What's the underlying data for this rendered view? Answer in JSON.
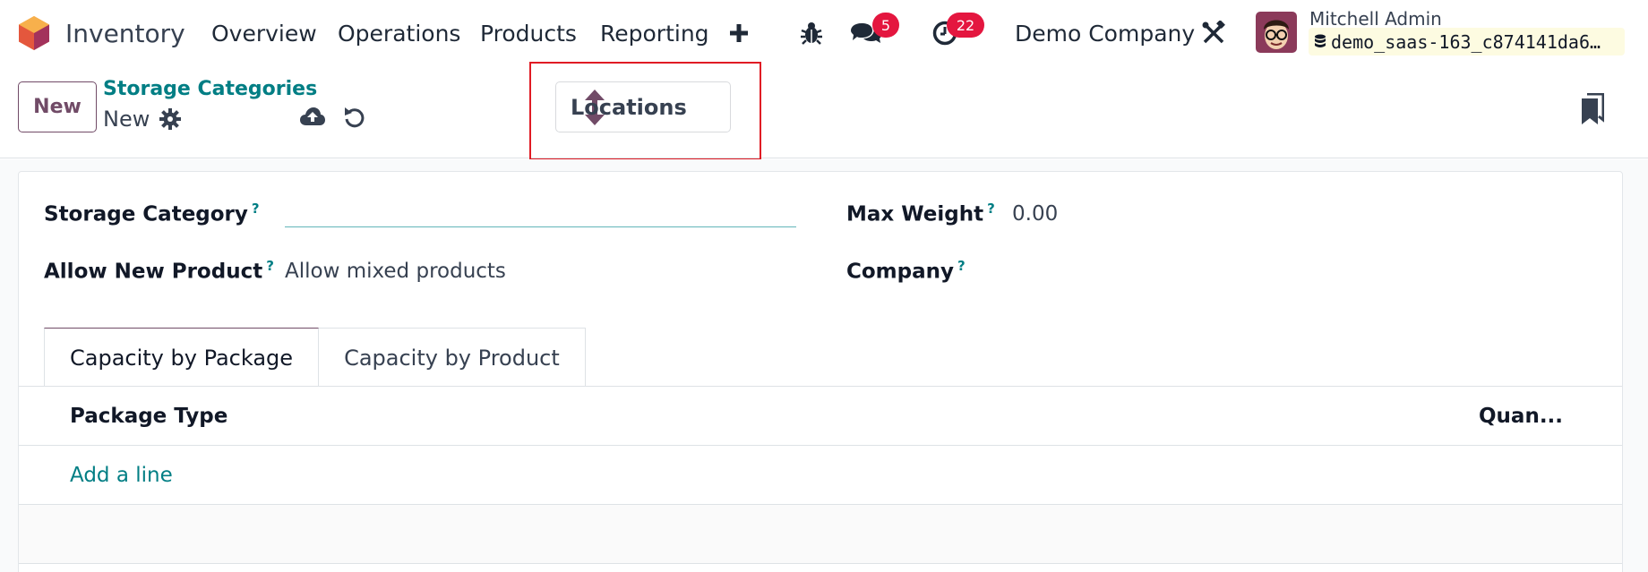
{
  "navbar": {
    "app_name": "Inventory",
    "menu": [
      "Overview",
      "Operations",
      "Products",
      "Reporting"
    ],
    "messages_count": "5",
    "activities_count": "22",
    "company": "Demo Company",
    "user_name": "Mitchell Admin",
    "database": "demo_saas-163_c874141da6…"
  },
  "control_panel": {
    "new_label": "New",
    "breadcrumb_parent": "Storage Categories",
    "breadcrumb_current": "New",
    "smart_button_label": "Locations"
  },
  "form": {
    "storage_category_label": "Storage Category",
    "storage_category_value": "",
    "allow_new_product_label": "Allow New Product",
    "allow_new_product_value": "Allow mixed products",
    "max_weight_label": "Max Weight",
    "max_weight_value": "0.00",
    "company_label": "Company",
    "tooltip_mark": "?"
  },
  "tabs": [
    "Capacity by Package",
    "Capacity by Product"
  ],
  "table": {
    "columns": [
      "Package Type",
      "Quan..."
    ],
    "add_line": "Add a line"
  },
  "colors": {
    "brand": "#714b67",
    "link": "#017e84",
    "badge": "#e4163f",
    "highlight": "#e01b24"
  }
}
